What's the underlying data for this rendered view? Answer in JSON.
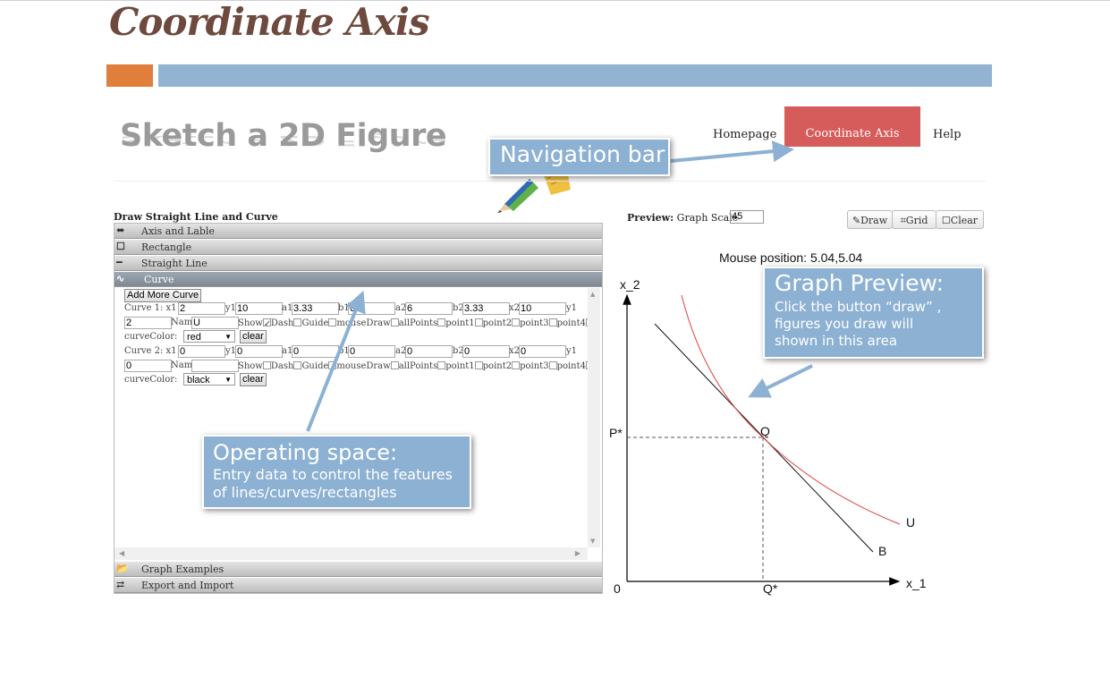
{
  "slide": {
    "title": "Coordinate Axis"
  },
  "logo": {
    "text": "Sketch a 2D Figure",
    "icon": "pencil-ruler-icon"
  },
  "nav": {
    "items": [
      "Homepage",
      "Coordinate Axis",
      "Help"
    ],
    "active": "Coordinate Axis",
    "active_color": "#d65b5b"
  },
  "callouts": {
    "navigation": {
      "title": "Navigation bar"
    },
    "operating": {
      "title": "Operating space:",
      "line1": "Entry data to control the features",
      "line2": "of lines/curves/rectangles"
    },
    "graph": {
      "title": "Graph Preview:",
      "line1": "Click the button “draw” ,",
      "line2": "figures you draw will",
      "line3": "shown  in this area"
    }
  },
  "left_panel": {
    "title": "Draw Straight Line and Curve",
    "sections": [
      {
        "icon": "⬌",
        "label": "Axis and Lable"
      },
      {
        "icon": "☐",
        "label": "Rectangle"
      },
      {
        "icon": "━",
        "label": "Straight Line"
      },
      {
        "icon": "∿",
        "label": "Curve"
      }
    ],
    "footer_sections": [
      {
        "icon": "📂",
        "label": "Graph Examples"
      },
      {
        "icon": "⇄",
        "label": "Export and Import"
      }
    ],
    "add_more_label": "Add More Curve",
    "clear_label": "clear",
    "curves": [
      {
        "label": "Curve 1:",
        "x1": "2",
        "y1": "10",
        "a1": "3.33",
        "b1": "6",
        "a2": "6",
        "b2": "3.33",
        "x2": "10",
        "y2": "2",
        "name": "U",
        "show_checked": true,
        "color": "red"
      },
      {
        "label": "Curve 2:",
        "x1": "0",
        "y1": "0",
        "a1": "0",
        "b1": "0",
        "a2": "0",
        "b2": "0",
        "x2": "0",
        "y2": "0",
        "name": "",
        "show_checked": false,
        "color": "black"
      }
    ],
    "field_labels": {
      "x1": "x1",
      "y1": "y1",
      "a1": "a1",
      "b1": "b1",
      "a2": "a2",
      "b2": "b2",
      "x2": "x2",
      "name": "Name",
      "color": "curveColor:"
    },
    "checkbox_labels": [
      "Show",
      "Dash",
      "Guide",
      "mouseDraw",
      "allPoints",
      "point1",
      "point2",
      "point3",
      "point4"
    ]
  },
  "preview": {
    "label": "Preview:",
    "scale_label": "Graph Scale",
    "scale_value": "45",
    "buttons": {
      "draw": "Draw",
      "grid": "Grid",
      "clear": "Clear"
    },
    "mouse_position": "Mouse position: 5.04,5.04"
  },
  "graph_labels": {
    "x_axis": "x_1",
    "y_axis": "x_2",
    "origin": "0",
    "p_star": "P*",
    "q_star": "Q*",
    "q_point": "Q",
    "curve_label": "U",
    "line_label": "B"
  },
  "colors": {
    "accent_orange": "#e07e3c",
    "accent_blue": "#93b3d2",
    "callout_bg": "#8db1d3",
    "curve_red": "#e04040"
  }
}
